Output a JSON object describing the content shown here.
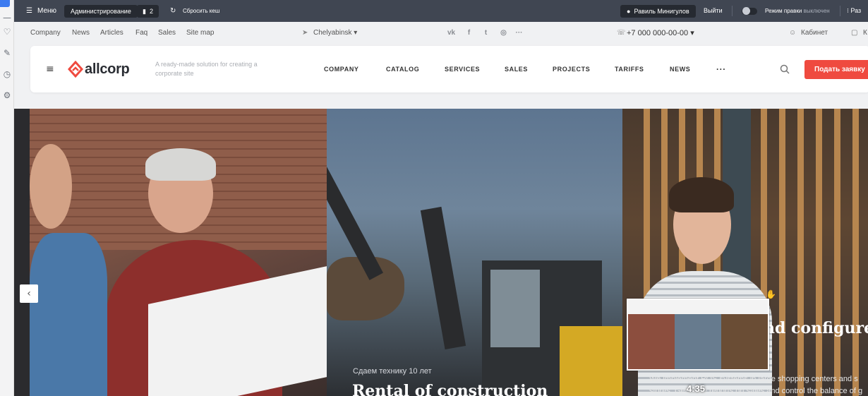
{
  "adminbar": {
    "menu_label": "Меню",
    "admin_label": "Администрирование",
    "notifications_count": "2",
    "reset_cache_label": "Сбросить кеш",
    "user_name": "Равиль Минигулов",
    "logout_label": "Выйти",
    "edit_mode_label": "Режим правки",
    "edit_mode_state": "выключен",
    "more_label": "Раз"
  },
  "topline": {
    "links": [
      "Company",
      "News",
      "Articles",
      "Faq",
      "Sales",
      "Site map"
    ],
    "city": "Chelyabinsk",
    "phone": "+7 000 000-00-00",
    "cabinet_label": "Кабинет",
    "cart_label": "К"
  },
  "header": {
    "brand": "allcorp",
    "tagline": "A ready-made solution for creating a corporate site",
    "nav": [
      "COMPANY",
      "CATALOG",
      "SERVICES",
      "SALES",
      "PROJECTS",
      "TARIFFS",
      "NEWS"
    ],
    "more": "···",
    "cta_label": "Подать заявку"
  },
  "slides": {
    "slide2_subtitle": "Сдаем технику 10 лет",
    "slide2_title": "Rental of construction",
    "slide3_title": "nd configure",
    "slide3_text": "We implement POS systems in large shopping centers and s stores. Generate reports on sales and control the balance of g"
  },
  "video": {
    "timestamp": "4:35"
  },
  "colors": {
    "accent": "#ef4a3f",
    "adminbar": "#404652",
    "link_blue": "#3d7bf0"
  }
}
